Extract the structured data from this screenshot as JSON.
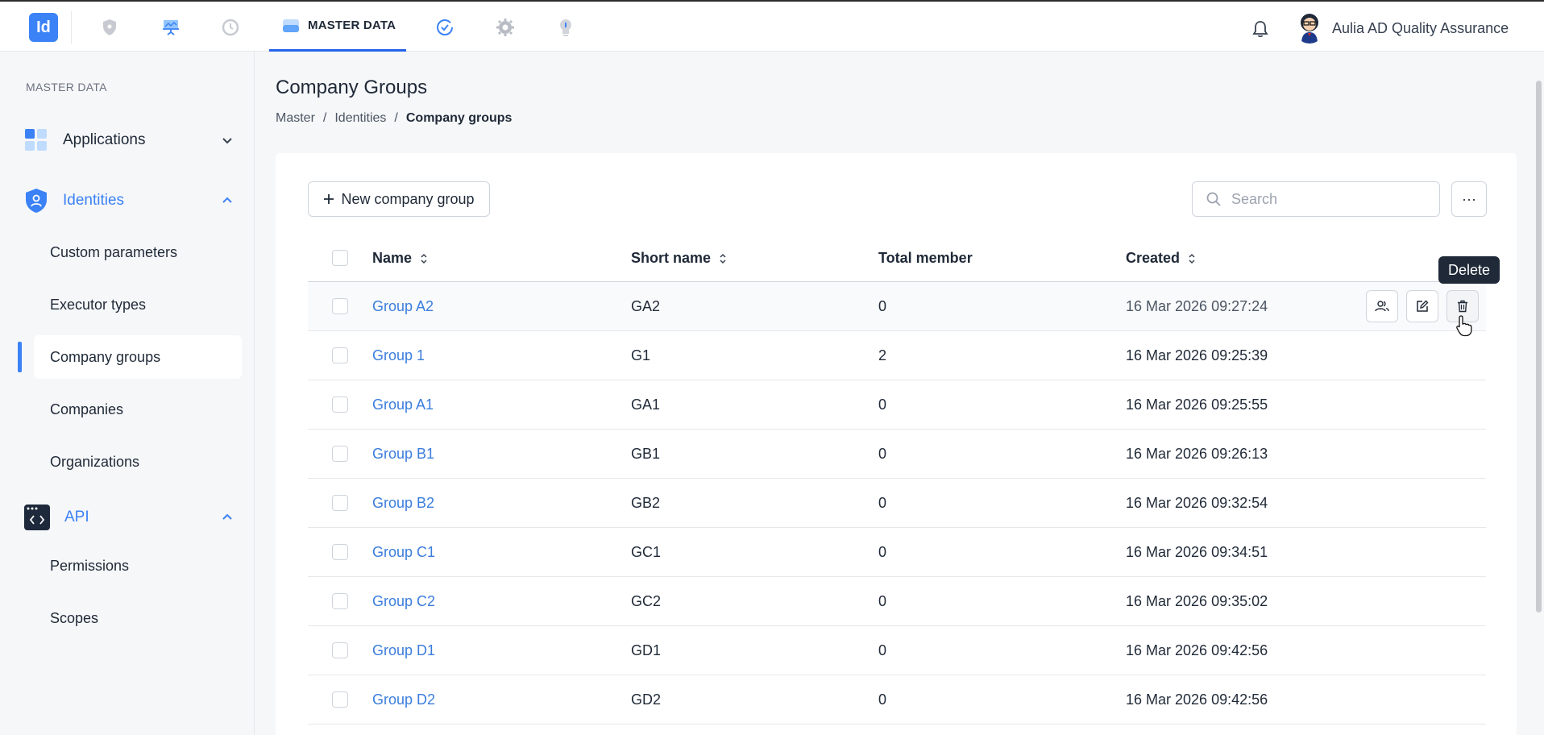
{
  "app": {
    "logo_text": "Id",
    "active_tab": "MASTER DATA",
    "user_name": "Aulia AD Quality Assurance"
  },
  "nav_icons": [
    "shield-icon",
    "presentation-icon",
    "history-icon",
    "clock-check-icon",
    "gear-icon",
    "lightbulb-icon"
  ],
  "sidebar": {
    "section_title": "MASTER DATA",
    "groups": {
      "applications": {
        "label": "Applications"
      },
      "identities": {
        "label": "Identities"
      },
      "api": {
        "label": "API"
      }
    },
    "identity_items": [
      "Custom parameters",
      "Executor types",
      "Company groups",
      "Companies",
      "Organizations"
    ],
    "api_items": [
      "Permissions",
      "Scopes"
    ]
  },
  "page": {
    "title": "Company Groups",
    "breadcrumb": [
      "Master",
      "Identities",
      "Company groups"
    ]
  },
  "toolbar": {
    "new_label": "New company group",
    "search_placeholder": "Search",
    "more_label": "···"
  },
  "table": {
    "columns": {
      "name": "Name",
      "short": "Short name",
      "total": "Total member",
      "created": "Created"
    },
    "rows": [
      {
        "name": "Group A2",
        "short": "GA2",
        "total": "0",
        "created": "16 Mar 2026 09:27:24"
      },
      {
        "name": "Group 1",
        "short": "G1",
        "total": "2",
        "created": "16 Mar 2026 09:25:39"
      },
      {
        "name": "Group A1",
        "short": "GA1",
        "total": "0",
        "created": "16 Mar 2026 09:25:55"
      },
      {
        "name": "Group B1",
        "short": "GB1",
        "total": "0",
        "created": "16 Mar 2026 09:26:13"
      },
      {
        "name": "Group B2",
        "short": "GB2",
        "total": "0",
        "created": "16 Mar 2026 09:32:54"
      },
      {
        "name": "Group C1",
        "short": "GC1",
        "total": "0",
        "created": "16 Mar 2026 09:34:51"
      },
      {
        "name": "Group C2",
        "short": "GC2",
        "total": "0",
        "created": "16 Mar 2026 09:35:02"
      },
      {
        "name": "Group D1",
        "short": "GD1",
        "total": "0",
        "created": "16 Mar 2026 09:42:56"
      },
      {
        "name": "Group D2",
        "short": "GD2",
        "total": "0",
        "created": "16 Mar 2026 09:42:56"
      }
    ]
  },
  "tooltip": {
    "text": "Delete"
  },
  "colors": {
    "accent": "#3b82f6",
    "link": "#3b7ddd",
    "tooltip_bg": "#1f2937"
  }
}
